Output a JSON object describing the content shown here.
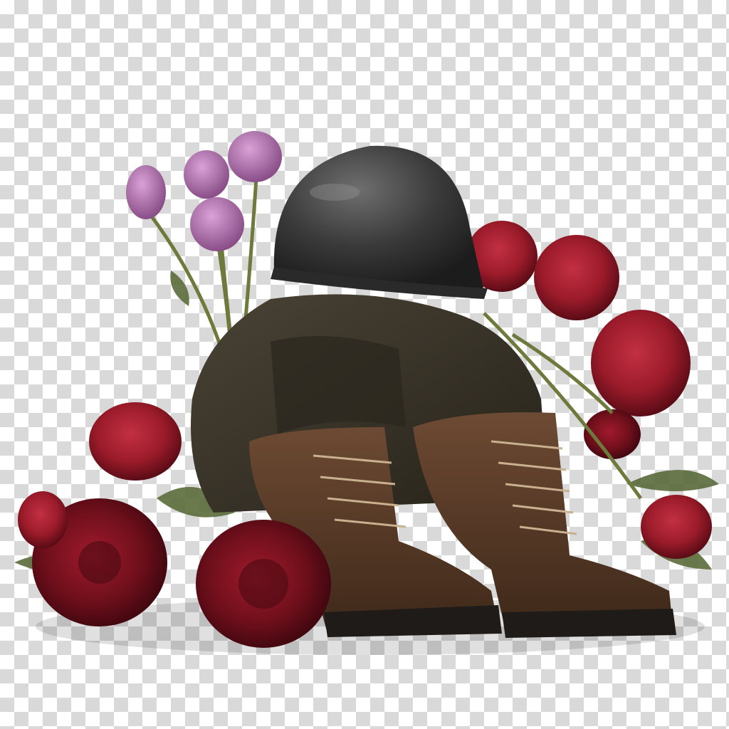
{
  "image": {
    "background": "transparency-checkerboard",
    "subject": [
      "helmet",
      "uniform",
      "boots",
      "roses"
    ]
  },
  "colors": {
    "checker_light": "#ffffff",
    "checker_dark": "#d9d9d9",
    "helmet": "#3a3a3a",
    "uniform": "#3b352c",
    "boot_leather": "#5a3c2a",
    "boot_sole": "#1f1b18",
    "rose_red": "#9b1b2a",
    "rose_deep": "#6e0f1b",
    "rose_purple": "#a86aa6",
    "leaf_green": "#5a6b3a"
  }
}
